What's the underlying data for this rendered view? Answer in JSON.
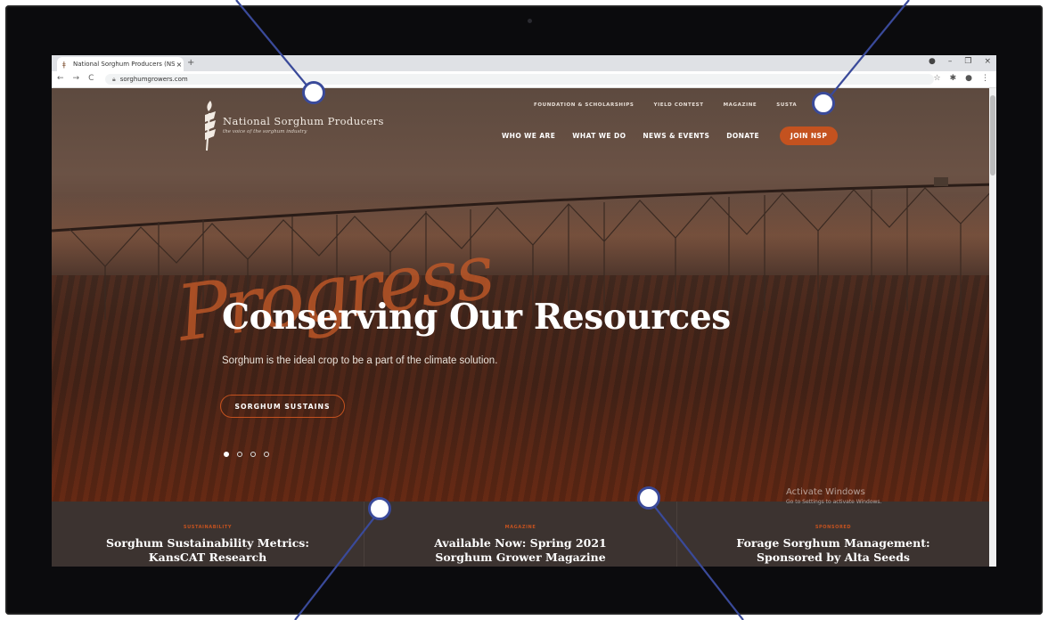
{
  "browser": {
    "tab_title": "National Sorghum Producers (NS",
    "url": "sorghumgrowers.com"
  },
  "site": {
    "brand": "National Sorghum Producers",
    "tagline": "the voice of the sorghum industry",
    "top_nav": [
      "FOUNDATION & SCHOLARSHIPS",
      "YIELD CONTEST",
      "MAGAZINE",
      "SUSTA"
    ],
    "main_nav": [
      "WHO WE ARE",
      "WHAT WE DO",
      "NEWS & EVENTS",
      "DONATE"
    ],
    "join_label": "JOIN NSP"
  },
  "hero": {
    "script_word": "Progress",
    "title": "Conserving Our Resources",
    "subtitle": "Sorghum is the ideal crop to be a part of the climate solution.",
    "button_label": "SORGHUM SUSTAINS",
    "slide_count": 4,
    "active_slide": 1
  },
  "news": [
    {
      "category": "SUSTAINABILITY",
      "headline": "Sorghum Sustainability Metrics:",
      "headline2": "KansCAT Research"
    },
    {
      "category": "MAGAZINE",
      "headline": "Available Now: Spring 2021",
      "headline2": "Sorghum Grower Magazine"
    },
    {
      "category": "SPONSORED",
      "headline": "Forage Sorghum Management:",
      "headline2": "Sponsored by Alta Seeds"
    }
  ],
  "watermark": {
    "line1": "Activate Windows",
    "line2": "Go to Settings to activate Windows."
  },
  "colors": {
    "accent": "#c4521f",
    "callout": "#3a4a9a"
  }
}
